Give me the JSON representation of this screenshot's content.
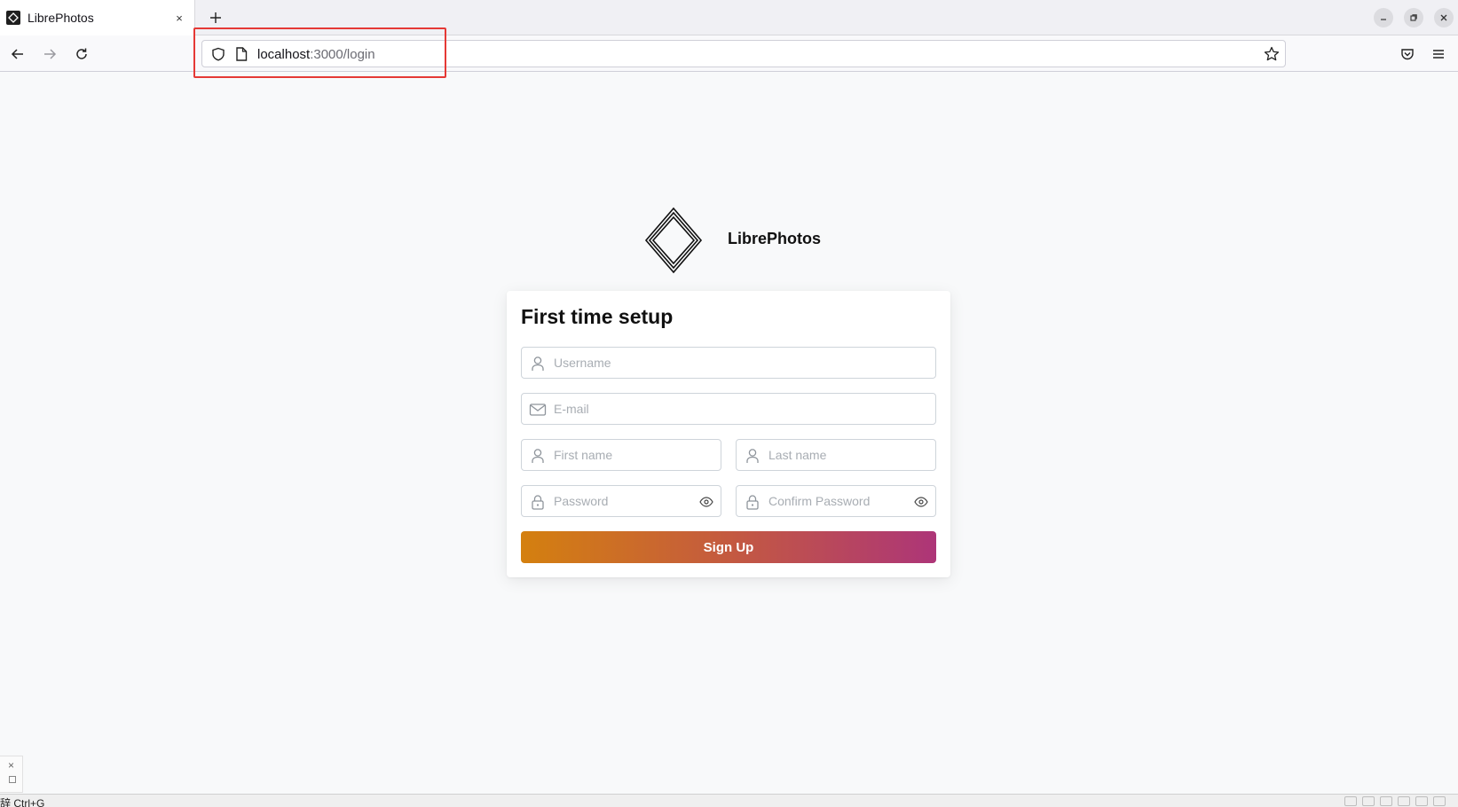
{
  "browser": {
    "tab": {
      "title": "LibrePhotos",
      "close_glyph": "×"
    },
    "new_tab_glyph": "+",
    "url": {
      "host": "localhost",
      "rest": ":3000/login"
    }
  },
  "app": {
    "brand_name": "LibrePhotos",
    "logo_icon": "librephotos-diamond-logo"
  },
  "form": {
    "title": "First time setup",
    "username": {
      "placeholder": "Username",
      "value": "",
      "icon": "user-icon"
    },
    "email": {
      "placeholder": "E-mail",
      "value": "",
      "icon": "mail-icon"
    },
    "first_name": {
      "placeholder": "First name",
      "value": "",
      "icon": "user-icon"
    },
    "last_name": {
      "placeholder": "Last name",
      "value": "",
      "icon": "user-icon"
    },
    "password": {
      "placeholder": "Password",
      "value": "",
      "icon": "lock-icon"
    },
    "confirm_password": {
      "placeholder": "Confirm Password",
      "value": "",
      "icon": "lock-icon"
    },
    "submit_label": "Sign Up",
    "submit_gradient": [
      "#d4800f",
      "#c45a40",
      "#ad3578"
    ]
  },
  "statusbar": {
    "text": "辞 Ctrl+G"
  },
  "annotation": {
    "highlight_color": "#e53935"
  }
}
